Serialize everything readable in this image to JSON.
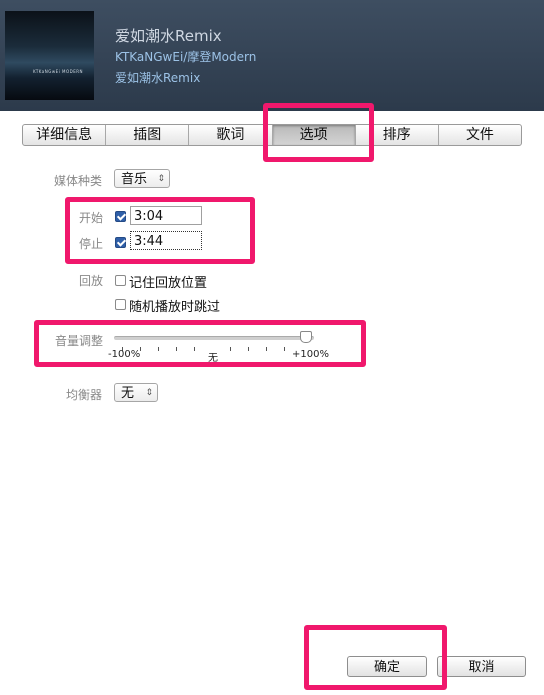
{
  "header": {
    "title": "爱如潮水Remix",
    "artist": "KTKaNGwEi/摩登Modern",
    "album": "爱如潮水Remix",
    "artwork_text": "KTKaNGwEi MODERN"
  },
  "tabs": [
    {
      "label": "详细信息",
      "active": false
    },
    {
      "label": "插图",
      "active": false
    },
    {
      "label": "歌词",
      "active": false
    },
    {
      "label": "选项",
      "active": true
    },
    {
      "label": "排序",
      "active": false
    },
    {
      "label": "文件",
      "active": false
    }
  ],
  "options": {
    "media_kind_label": "媒体种类",
    "media_kind_value": "音乐",
    "start_label": "开始",
    "start_checked": true,
    "start_value": "3:04",
    "stop_label": "停止",
    "stop_checked": true,
    "stop_value": "3:44",
    "playback_label": "回放",
    "remember_position": "记住回放位置",
    "skip_shuffle": "随机播放时跳过",
    "volume_label": "音量调整",
    "volume_min": "-100%",
    "volume_mid": "无",
    "volume_max": "+100%",
    "volume_level_percent": 96,
    "equalizer_label": "均衡器",
    "equalizer_value": "无"
  },
  "footer": {
    "ok_label": "确定",
    "cancel_label": "取消"
  },
  "colors": {
    "highlight": "#f0186c",
    "header_bg": "#34465a",
    "link_blue": "#9cc2e6"
  }
}
